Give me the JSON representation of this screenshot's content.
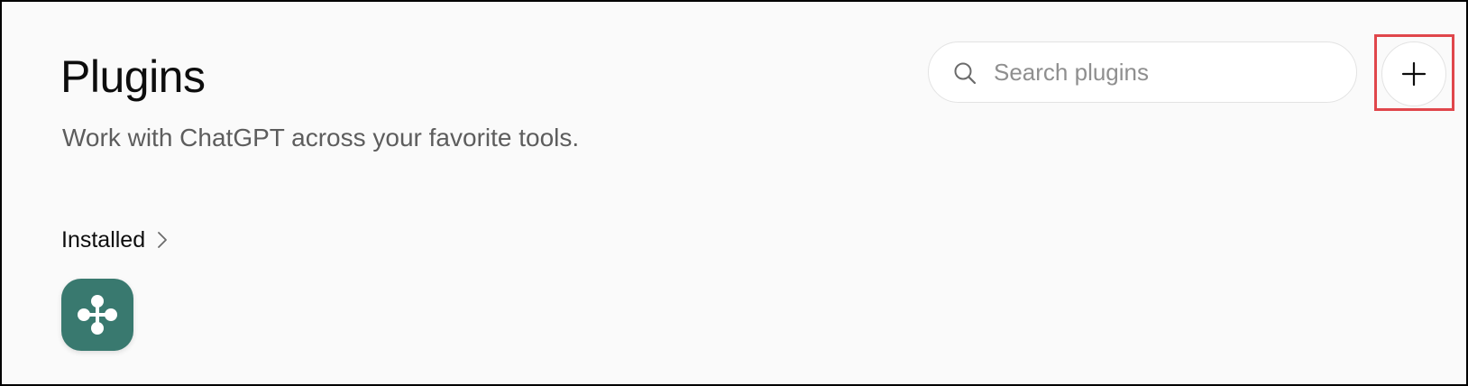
{
  "header": {
    "title": "Plugins",
    "subtitle": "Work with ChatGPT across your favorite tools."
  },
  "search": {
    "placeholder": "Search plugins",
    "value": "",
    "icon": "search-icon"
  },
  "add_button": {
    "icon": "plus-icon",
    "highlighted": true,
    "highlight_color": "#e0464b"
  },
  "installed": {
    "label": "Installed",
    "chevron_icon": "chevron-right-icon",
    "plugins": [
      {
        "icon": "connector-icon",
        "tile_color": "#39796f"
      }
    ]
  },
  "colors": {
    "background": "#fafafa",
    "text_primary": "#0d0d0d",
    "text_secondary": "#5d5d5d"
  }
}
